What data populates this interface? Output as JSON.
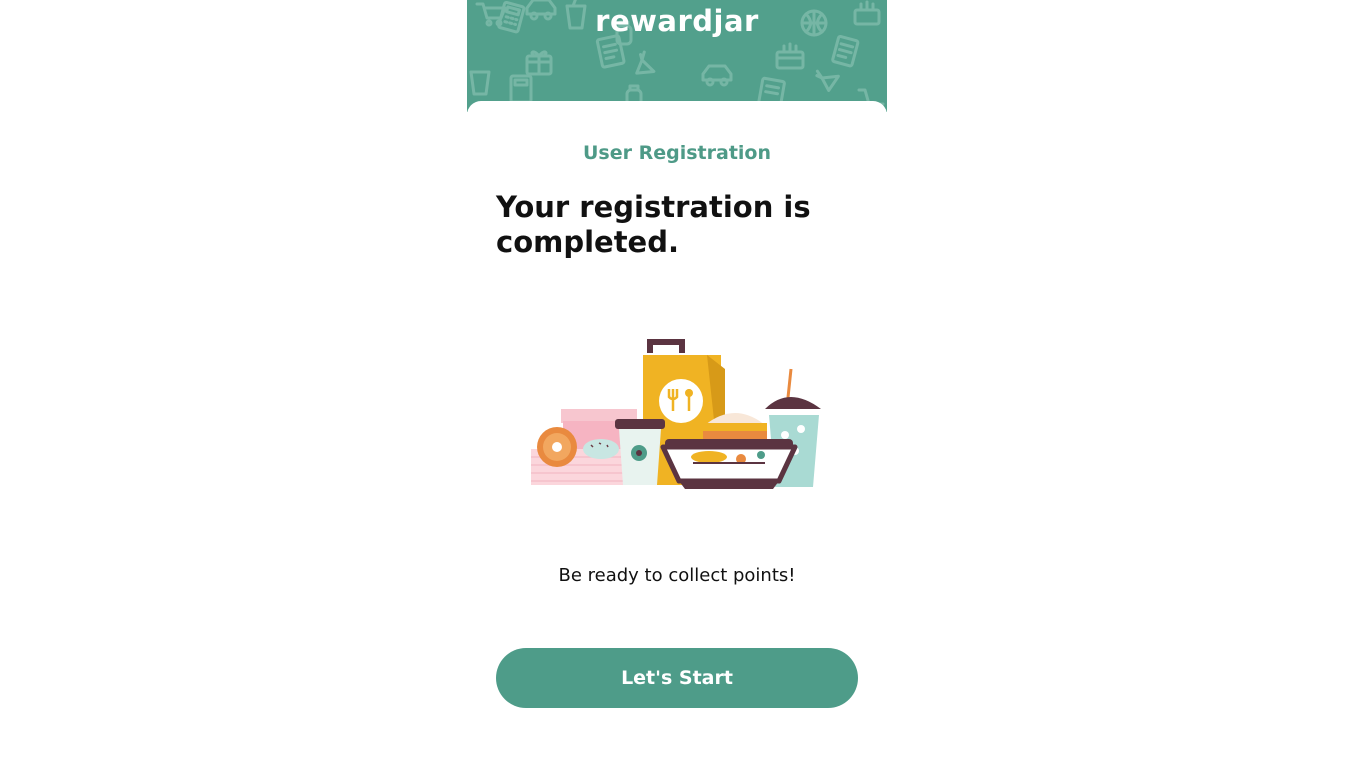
{
  "header": {
    "logo_text": "rewardjar",
    "background_color": "#52a08c",
    "pattern_icons": [
      "cart-icon",
      "cake-icon",
      "car-icon",
      "gift-icon",
      "book-icon",
      "baby-bottle-icon",
      "basketball-icon",
      "carrot-icon",
      "calculator-icon",
      "cup-icon"
    ]
  },
  "card": {
    "subtitle": "User Registration",
    "headline": "Your registration is completed.",
    "illustration_icon": "food-takeaway-illustration",
    "message": "Be ready to collect points!",
    "button_label": "Let's Start",
    "accent_color": "#4e9c89"
  }
}
